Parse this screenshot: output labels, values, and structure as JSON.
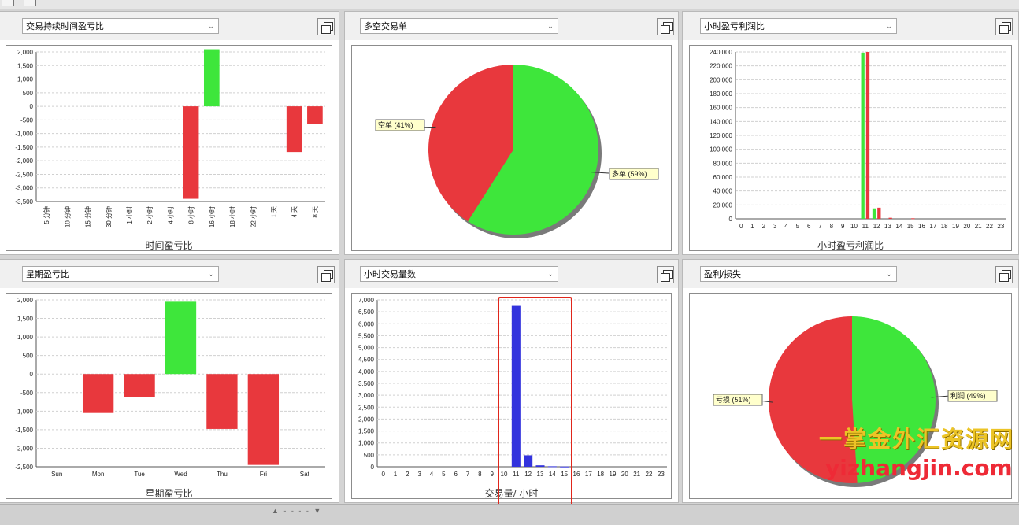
{
  "toolbar": {},
  "panels": [
    {
      "id": "p1",
      "dropdown": "交易持续时间盈亏比",
      "chart_title": "时间盈亏比"
    },
    {
      "id": "p2",
      "dropdown": "多空交易单",
      "chart_title": ""
    },
    {
      "id": "p3",
      "dropdown": "小时盈亏利润比",
      "chart_title": "小时盈亏利润比"
    },
    {
      "id": "p4",
      "dropdown": "星期盈亏比",
      "chart_title": "星期盈亏比"
    },
    {
      "id": "p5",
      "dropdown": "小时交易量数",
      "chart_title": "交易量/ 小时"
    },
    {
      "id": "p6",
      "dropdown": "盈利/损失",
      "chart_title": ""
    }
  ],
  "watermark": {
    "line1": "一掌金外汇资源网",
    "line2": "yizhangjin.com"
  },
  "colors": {
    "loss_red": "#e8383d",
    "profit_green": "#3ee63b",
    "volume_blue": "#3333dd",
    "highlight_red": "#e0261b"
  },
  "chart_data": [
    {
      "type": "bar",
      "categories": [
        "5 分钟",
        "10 分钟",
        "15 分钟",
        "30 分钟",
        "1 小时",
        "2 小时",
        "4 小时",
        "8 小时",
        "16 小时",
        "18 小时",
        "22 小时",
        "1 天",
        "4 天",
        "8 天"
      ],
      "values": [
        0,
        0,
        0,
        0,
        0,
        0,
        0,
        -3400,
        2100,
        0,
        0,
        0,
        -1680,
        -650
      ],
      "xlabel": "时间盈亏比",
      "ylim": [
        -3500,
        2000
      ],
      "yticks": [
        2000,
        1500,
        1000,
        500,
        0,
        -500,
        -1000,
        -1500,
        -2000,
        -2500,
        -3000,
        -3500
      ],
      "grid": true
    },
    {
      "type": "pie",
      "slices": [
        {
          "label": "多单",
          "percent": 59,
          "text": "多单 (59%)",
          "color": "#3ee63b"
        },
        {
          "label": "空单",
          "percent": 41,
          "text": "空单 (41%)",
          "color": "#e8383d"
        }
      ]
    },
    {
      "type": "bar",
      "categories": [
        "0",
        "1",
        "2",
        "3",
        "4",
        "5",
        "6",
        "7",
        "8",
        "9",
        "10",
        "11",
        "12",
        "13",
        "14",
        "15",
        "16",
        "17",
        "18",
        "19",
        "20",
        "21",
        "22",
        "23"
      ],
      "series": [
        {
          "color": "#3ee63b",
          "values": [
            0,
            0,
            0,
            0,
            0,
            0,
            0,
            0,
            0,
            0,
            0,
            239000,
            15000,
            0,
            0,
            0,
            0,
            0,
            0,
            0,
            0,
            0,
            0,
            0
          ]
        },
        {
          "color": "#e8383d",
          "values": [
            0,
            0,
            0,
            0,
            0,
            0,
            0,
            0,
            0,
            0,
            0,
            240000,
            16000,
            1500,
            0,
            800,
            0,
            0,
            0,
            0,
            0,
            0,
            0,
            0
          ]
        }
      ],
      "xlabel": "小时盈亏利润比",
      "ylim": [
        0,
        240000
      ],
      "yticks": [
        240000,
        220000,
        200000,
        180000,
        160000,
        140000,
        120000,
        100000,
        80000,
        60000,
        40000,
        20000,
        0
      ],
      "ytick_labels": [
        "240,000",
        "220,000",
        "200,000",
        "180,000",
        "160,000",
        "140,000",
        "120,000",
        "100,000",
        "80,000",
        "60,000",
        "40,000",
        "20,000",
        "0"
      ],
      "grid": true
    },
    {
      "type": "bar",
      "categories": [
        "Sun",
        "Mon",
        "Tue",
        "Wed",
        "Thu",
        "Fri",
        "Sat"
      ],
      "values": [
        0,
        -1050,
        -620,
        1950,
        -1480,
        -2450,
        0
      ],
      "xlabel": "星期盈亏比",
      "ylim": [
        -2500,
        2000
      ],
      "yticks": [
        2000,
        1500,
        1000,
        500,
        0,
        -500,
        -1000,
        -1500,
        -2000,
        -2500
      ],
      "ytick_labels": [
        "2,000",
        "1,500",
        "1,000",
        "500",
        "0",
        "-500",
        "-1,000",
        "-1,500",
        "-2,000",
        "-2,500"
      ],
      "grid": true
    },
    {
      "type": "bar",
      "categories": [
        "0",
        "1",
        "2",
        "3",
        "4",
        "5",
        "6",
        "7",
        "8",
        "9",
        "10",
        "11",
        "12",
        "13",
        "14",
        "15",
        "16",
        "17",
        "18",
        "19",
        "20",
        "21",
        "22",
        "23"
      ],
      "values": [
        0,
        0,
        0,
        0,
        0,
        0,
        0,
        0,
        0,
        0,
        0,
        6750,
        480,
        60,
        20,
        10,
        0,
        0,
        0,
        0,
        0,
        0,
        0,
        0
      ],
      "xlabel": "交易量/ 小时",
      "ylim": [
        0,
        7000
      ],
      "yticks": [
        7000,
        6500,
        6000,
        5500,
        5000,
        4500,
        4000,
        3500,
        3000,
        2500,
        2000,
        1500,
        1000,
        500,
        0
      ],
      "ytick_labels": [
        "7,000",
        "6,500",
        "6,000",
        "5,500",
        "5,000",
        "4,500",
        "4,000",
        "3,500",
        "3,000",
        "2,500",
        "2,000",
        "1,500",
        "1,000",
        "500",
        "0"
      ],
      "grid": true
    },
    {
      "type": "pie",
      "slices": [
        {
          "label": "利润",
          "percent": 49,
          "text": "利润 (49%)",
          "color": "#3ee63b"
        },
        {
          "label": "亏损",
          "percent": 51,
          "text": "亏损 (51%)",
          "color": "#e8383d"
        }
      ]
    }
  ]
}
